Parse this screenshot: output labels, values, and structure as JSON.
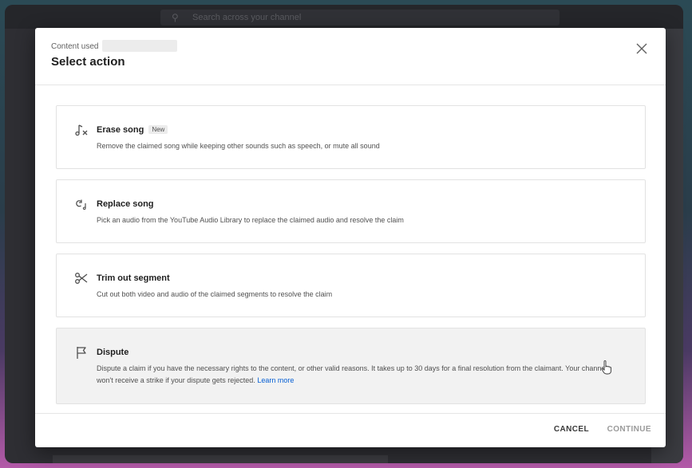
{
  "background": {
    "search_placeholder": "Search across your channel"
  },
  "dialog": {
    "subtitle": "Content used",
    "title": "Select action",
    "options": [
      {
        "icon": "music-note-erase-icon",
        "name": "Erase song",
        "badge": "New",
        "description": "Remove the claimed song while keeping other sounds such as speech, or mute all sound"
      },
      {
        "icon": "replace-audio-icon",
        "name": "Replace song",
        "description": "Pick an audio from the YouTube Audio Library to replace the claimed audio and resolve the claim"
      },
      {
        "icon": "scissors-icon",
        "name": "Trim out segment",
        "description": "Cut out both video and audio of the claimed segments to resolve the claim"
      },
      {
        "icon": "flag-icon",
        "name": "Dispute",
        "description": "Dispute a claim if you have the necessary rights to the content, or other valid reasons. It takes up to 30 days for a final resolution from the claimant. Your channel won't receive a strike if your dispute gets rejected.",
        "link": "Learn more"
      }
    ],
    "cancel_label": "CANCEL",
    "continue_label": "CONTINUE"
  },
  "colors": {
    "link": "#065fd4",
    "hover_row": "#f2f2f2",
    "disabled_text": "#9a9a9a"
  }
}
